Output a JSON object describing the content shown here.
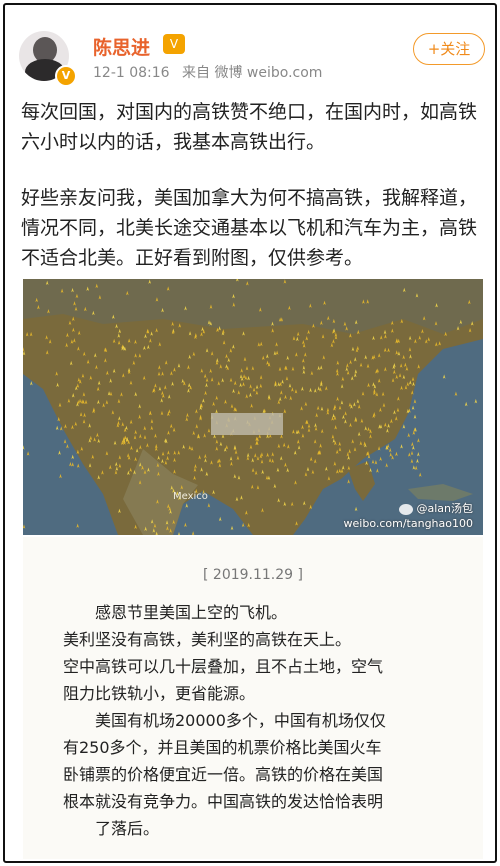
{
  "post": {
    "username": "陈思进",
    "user_badge": "V",
    "verified_badge": "V",
    "time": "12-1 08:16",
    "source": "来自 微博 weibo.com",
    "follow_label": "+关注",
    "paragraph1": "每次回国，对国内的高铁赞不绝口，在国内时，如高铁六小时以内的话，我基本高铁出行。",
    "paragraph2": "好些亲友问我，美国加拿大为何不搞高铁，我解释道，情况不同，北美长途交通基本以飞机和汽车为主，高铁不适合北美。正好看到附图，仅供参考。"
  },
  "image": {
    "map_label": "Mexico",
    "watermark_handle": "@alan汤包",
    "watermark_url": "weibo.com/tanghao100"
  },
  "caption": {
    "date": "[ 2019.11.29 ]",
    "lines": [
      "感恩节里美国上空的飞机。",
      "美利坚没有高铁，美利坚的高铁在天上。",
      "空中高铁可以几十层叠加，且不占土地，空气",
      "阻力比铁轨小，更省能源。",
      "美国有机场20000多个，中国有机场仅仅",
      "有250多个，并且美国的机票价格比美国火车",
      "卧铺票的价格便宜近一倍。高铁的价格在美国",
      "根本就没有竞争力。中国高铁的发达恰恰表明",
      "了落后。"
    ]
  },
  "colors": {
    "username": "#e8632c",
    "follow": "#f08a1a",
    "ocean": "#4f6b80",
    "land": "#7a6a3c",
    "planes": "#e8c12a"
  }
}
